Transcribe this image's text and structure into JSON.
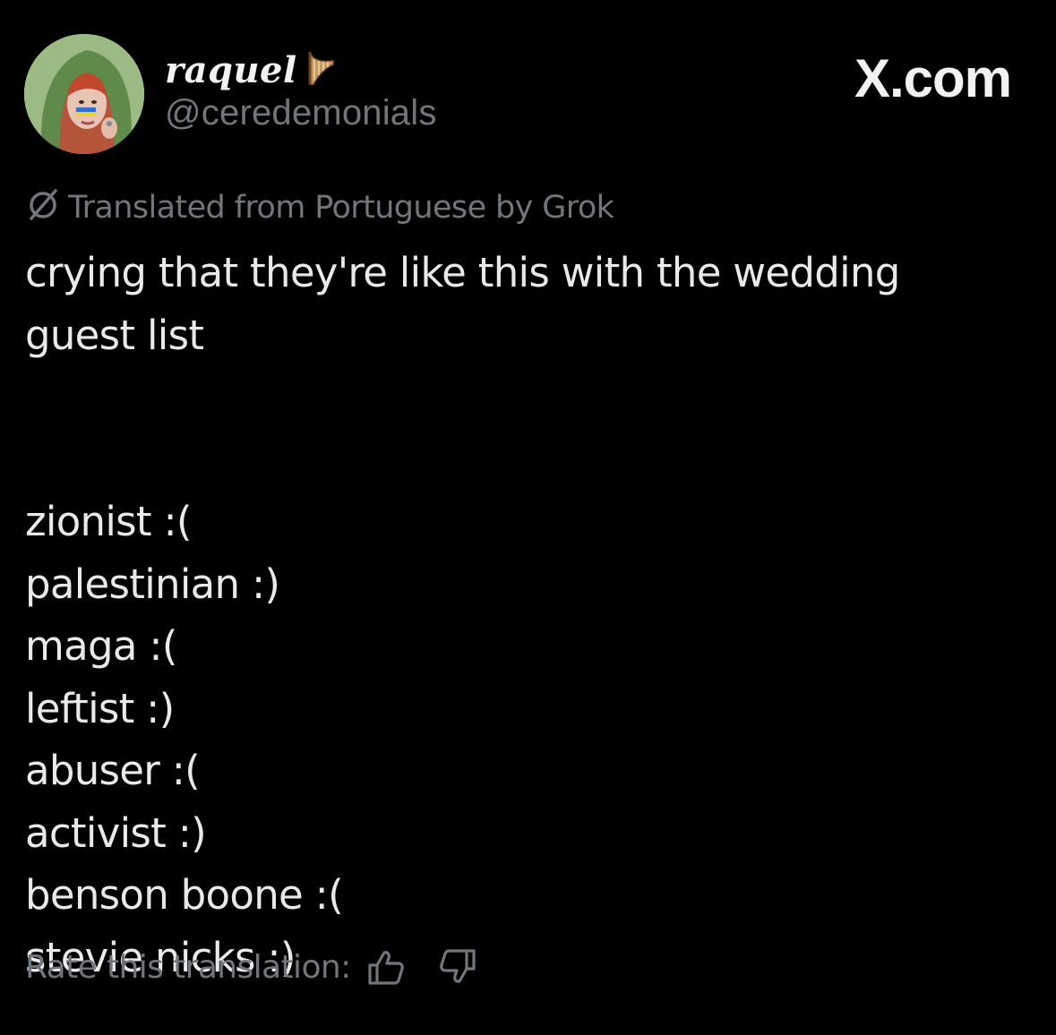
{
  "profile": {
    "display_name": "raquel",
    "name_emoji": "harp-icon",
    "handle": "@ceredemonials"
  },
  "brand": {
    "label": "X.com"
  },
  "translation": {
    "icon": "translate-icon",
    "label": "Translated from Portuguese by Grok"
  },
  "post": {
    "intro_line_1": "crying that they're like this with the wedding",
    "intro_line_2": "guest list",
    "list": [
      "zionist :(",
      "palestinian :)",
      "maga :(",
      "leftist :)",
      "abuser :(",
      "activist :)",
      "benson boone :(",
      "stevie nicks :)"
    ]
  },
  "rating": {
    "label": "Rate this translation:",
    "up_icon": "thumbs-up-icon",
    "down_icon": "thumbs-down-icon"
  },
  "colors": {
    "background": "#000000",
    "primary_text": "#e7e9ea",
    "secondary_text": "#71767b"
  }
}
